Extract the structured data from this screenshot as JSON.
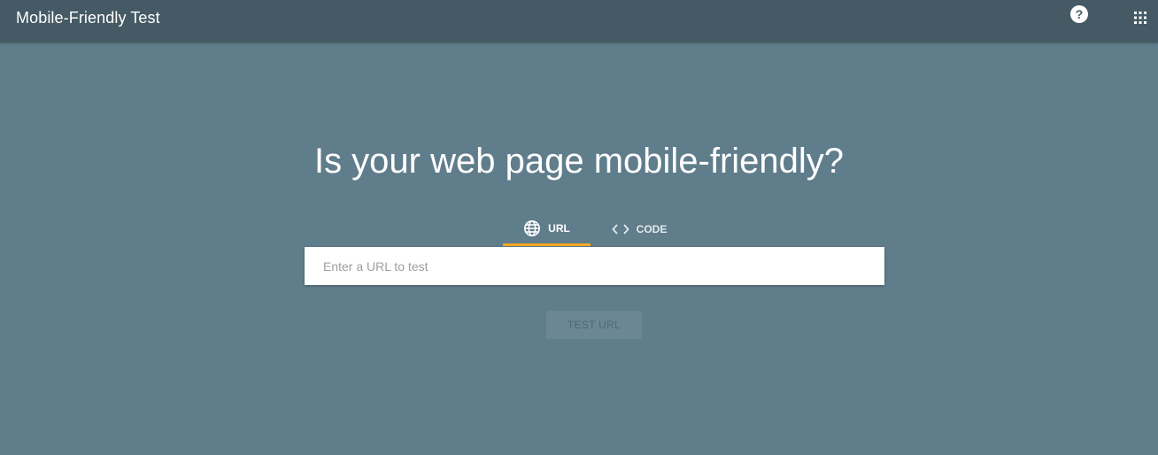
{
  "header": {
    "title": "Mobile-Friendly Test",
    "help_label": "?",
    "help_icon": "help-circle-icon",
    "apps_icon": "apps-grid-icon"
  },
  "main": {
    "heading": "Is your web page mobile-friendly?",
    "tabs": [
      {
        "label": "URL",
        "icon": "globe-icon",
        "selected": true
      },
      {
        "label": "CODE",
        "icon": "code-icon",
        "selected": false
      }
    ],
    "url_input": {
      "placeholder": "Enter a URL to test",
      "value": ""
    },
    "test_button": "TEST URL"
  },
  "colors": {
    "appbar": "#455a64",
    "background": "#607d8b",
    "tab_indicator": "#f9a825"
  }
}
